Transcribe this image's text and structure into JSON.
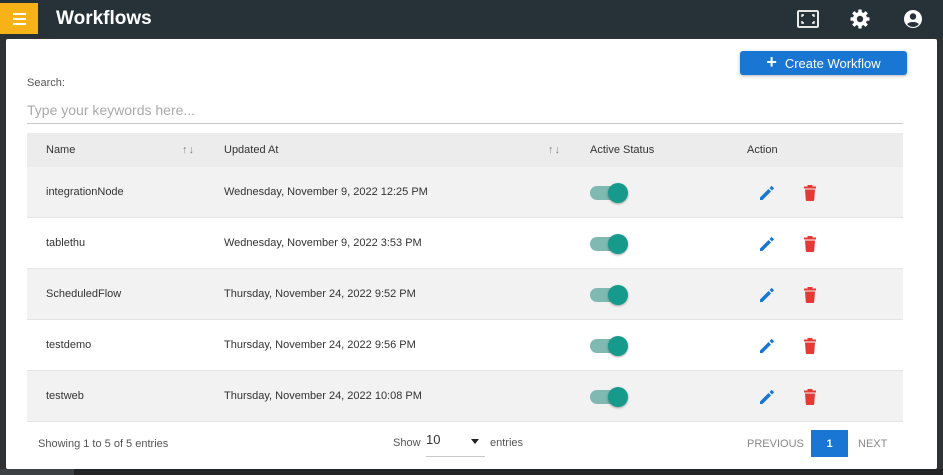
{
  "app": {
    "title": "Workflows"
  },
  "toolbar": {
    "create_label": "Create Workflow"
  },
  "search": {
    "label": "Search:",
    "placeholder": "Type your keywords here..."
  },
  "table": {
    "columns": [
      "Name",
      "Updated At",
      "Active Status",
      "Action"
    ],
    "rows": [
      {
        "name": "integrationNode",
        "updated_at": "Wednesday, November 9, 2022 12:25 PM",
        "active": true
      },
      {
        "name": "tablethu",
        "updated_at": "Wednesday, November 9, 2022 3:53 PM",
        "active": true
      },
      {
        "name": "ScheduledFlow",
        "updated_at": "Thursday, November 24, 2022 9:52 PM",
        "active": true
      },
      {
        "name": "testdemo",
        "updated_at": "Thursday, November 24, 2022 9:56 PM",
        "active": true
      },
      {
        "name": "testweb",
        "updated_at": "Thursday, November 24, 2022 10:08 PM",
        "active": true
      }
    ]
  },
  "footer": {
    "info": "Showing 1 to 5 of 5 entries",
    "show_label": "Show",
    "page_size": "10",
    "entries_label": "entries",
    "prev_label": "PREVIOUS",
    "current_page": "1",
    "next_label": "NEXT"
  },
  "icons": {
    "menu": "hamburger-icon",
    "fullscreen": "fullscreen-icon",
    "settings": "gear-icon",
    "account": "account-icon",
    "sort": "sort-icon",
    "edit": "pencil-icon",
    "delete": "trash-icon"
  },
  "colors": {
    "topbar": "#263238",
    "menu_button": "#f6b217",
    "primary": "#1976d2",
    "toggle_on": "#169a8c",
    "delete": "#e53935"
  }
}
